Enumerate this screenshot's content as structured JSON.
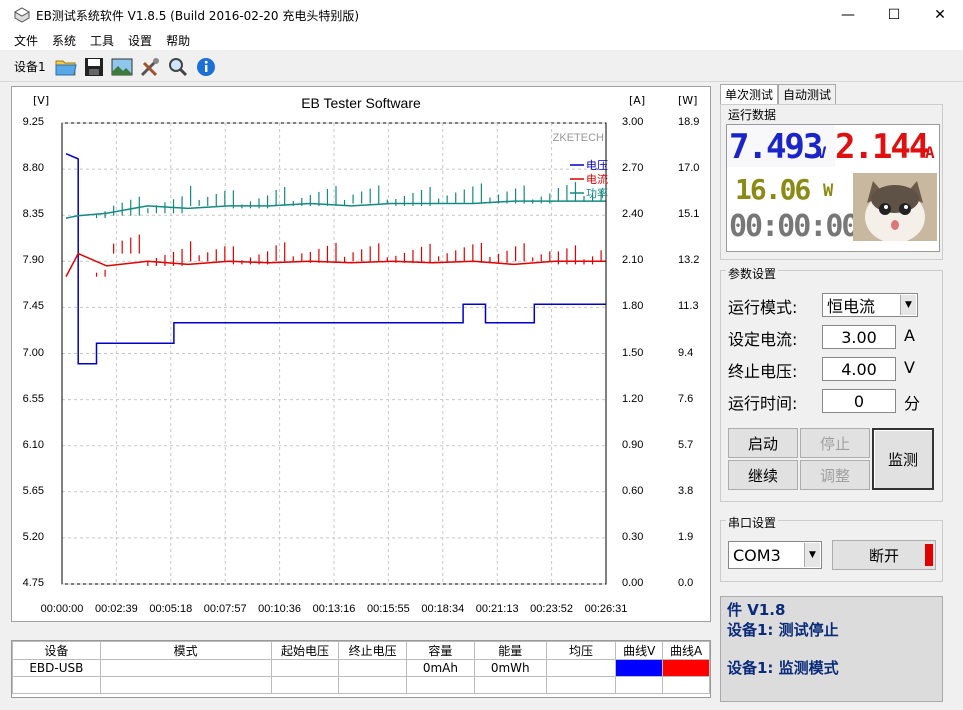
{
  "window": {
    "title": "EB测试系统软件 V1.8.5 (Build 2016-02-20 充电头特别版)",
    "min": "—",
    "max": "☐",
    "close": "✕"
  },
  "menu": [
    "文件",
    "系统",
    "工具",
    "设置",
    "帮助"
  ],
  "toolbar": {
    "device_label": "设备1"
  },
  "chart": {
    "title": "EB Tester Software",
    "brand": "ZKETECH",
    "unit_v": "[V]",
    "unit_a": "[A]",
    "unit_w": "[W]"
  },
  "chart_data": {
    "type": "line",
    "title": "EB Tester Software",
    "x_ticks": [
      "00:00:00",
      "00:02:39",
      "00:05:18",
      "00:07:57",
      "00:10:36",
      "00:13:16",
      "00:15:55",
      "00:18:34",
      "00:21:13",
      "00:23:52",
      "00:26:31"
    ],
    "y_left_ticks": [
      "9.25",
      "8.80",
      "8.35",
      "7.90",
      "7.45",
      "7.00",
      "6.55",
      "6.10",
      "5.65",
      "5.20",
      "4.75"
    ],
    "y_mid_ticks": [
      "3.00",
      "2.70",
      "2.40",
      "2.10",
      "1.80",
      "1.50",
      "1.20",
      "0.90",
      "0.60",
      "0.30",
      "0.00"
    ],
    "y_right_ticks": [
      "18.9",
      "17.0",
      "15.1",
      "13.2",
      "11.3",
      "9.4",
      "7.6",
      "5.7",
      "3.8",
      "1.9",
      "0.0"
    ],
    "ylim_v": [
      4.75,
      9.25
    ],
    "ylim_a": [
      0,
      3.0
    ],
    "ylim_w": [
      0,
      18.9
    ],
    "grid": true,
    "legend": "top-right",
    "series": [
      {
        "name": "电压",
        "color": "#0000c8",
        "x": [
          0,
          0.6,
          0.6,
          1.5,
          1.5,
          5.3,
          5.3,
          10,
          15,
          19.5,
          19.5,
          20.6,
          20.6,
          23,
          23,
          26.5
        ],
        "values": [
          8.95,
          8.9,
          6.9,
          6.9,
          7.1,
          7.1,
          7.3,
          7.3,
          7.3,
          7.3,
          7.48,
          7.48,
          7.3,
          7.3,
          7.48,
          7.48
        ]
      },
      {
        "name": "电流",
        "color": "#e00000",
        "x": [
          0,
          0.6,
          2,
          4,
          6,
          8,
          10,
          12,
          14,
          16,
          18,
          20,
          22,
          24,
          26.5
        ],
        "values": [
          2.0,
          2.15,
          2.07,
          2.1,
          2.08,
          2.1,
          2.09,
          2.1,
          2.09,
          2.1,
          2.09,
          2.1,
          2.08,
          2.1,
          2.1
        ]
      },
      {
        "name": "功率",
        "color": "#138a80",
        "x": [
          0,
          0.6,
          2,
          4,
          6,
          8,
          10,
          12,
          14,
          16,
          18,
          20,
          22,
          24,
          26.5
        ],
        "values": [
          15.0,
          15.1,
          15.2,
          15.5,
          15.4,
          15.5,
          15.5,
          15.6,
          15.5,
          15.6,
          15.6,
          15.6,
          15.7,
          15.7,
          15.7
        ]
      }
    ]
  },
  "table": {
    "headers": [
      "设备",
      "模式",
      "起始电压",
      "终止电压",
      "容量",
      "能量",
      "均压",
      "曲线V",
      "曲线A"
    ],
    "row": [
      "EBD-USB",
      "",
      "",
      "",
      "0mAh",
      "0mWh",
      "",
      "",
      ""
    ],
    "curve_v_color": "#0000ff",
    "curve_a_color": "#ff0000"
  },
  "tabs": [
    "单次测试",
    "自动测试"
  ],
  "run_data": {
    "group": "运行数据",
    "voltage": "7.493",
    "v_unit": "V",
    "current": "2.144",
    "a_unit": "A",
    "power": "16.06",
    "w_unit": "W",
    "time": "00:00:00"
  },
  "params": {
    "group": "参数设置",
    "mode_label": "运行模式:",
    "mode_value": "恒电流",
    "current_label": "设定电流:",
    "current_value": "3.00",
    "current_unit": "A",
    "stop_label": "终止电压:",
    "stop_value": "4.00",
    "stop_unit": "V",
    "time_label": "运行时间:",
    "time_value": "0",
    "time_unit": "分"
  },
  "buttons": {
    "start": "启动",
    "stop": "停止",
    "continue": "继续",
    "adjust": "调整",
    "monitor": "监测"
  },
  "serial": {
    "group": "串口设置",
    "port": "COM3",
    "disconnect": "断开"
  },
  "status": {
    "line1": "件 V1.8",
    "line2": "设备1: 测试停止",
    "line3": "设备1: 监测模式"
  }
}
